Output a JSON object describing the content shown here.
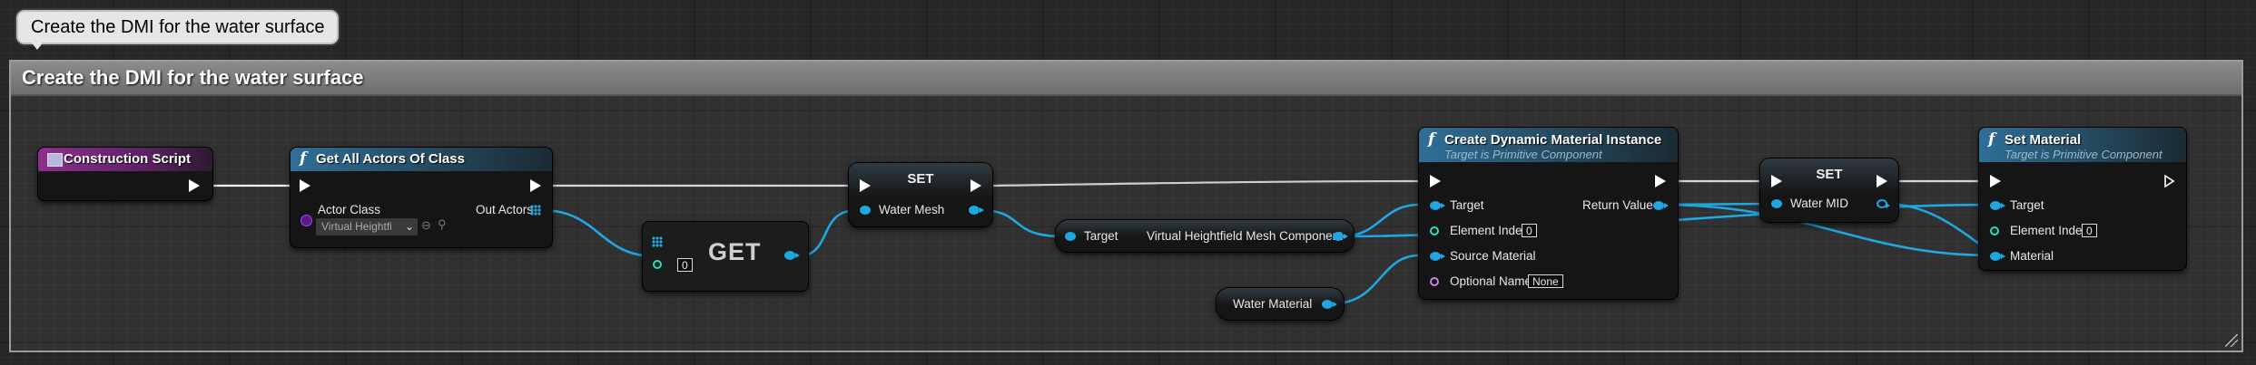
{
  "comment": {
    "bubble_text": "Create the DMI for the water surface",
    "title": "Create the DMI for the water surface"
  },
  "nodes": {
    "construction_script": {
      "title": "Construction Script"
    },
    "get_all_actors": {
      "title": "Get All Actors Of Class",
      "actor_class_label": "Actor Class",
      "actor_class_value": "Virtual Heightfi",
      "out_actors_label": "Out Actors"
    },
    "get_array": {
      "label": "GET",
      "index_value": "0"
    },
    "set_water_mesh": {
      "title": "SET",
      "pin_label": "Water Mesh"
    },
    "target_component": {
      "target_label": "Target",
      "component_label": "Virtual Heightfield Mesh Component"
    },
    "water_material": {
      "label": "Water Material"
    },
    "create_dmi": {
      "title": "Create Dynamic Material Instance",
      "subtitle": "Target is Primitive Component",
      "target_label": "Target",
      "element_index_label": "Element Index",
      "element_index_value": "0",
      "source_material_label": "Source Material",
      "optional_name_label": "Optional Name",
      "optional_name_value": "None",
      "return_value_label": "Return Value"
    },
    "set_water_mid": {
      "title": "SET",
      "pin_label": "Water MID"
    },
    "set_material": {
      "title": "Set Material",
      "subtitle": "Target is Primitive Component",
      "target_label": "Target",
      "element_index_label": "Element Index",
      "element_index_value": "0",
      "material_label": "Material"
    }
  },
  "colors": {
    "exec_wire": "#ffffff",
    "object_pin": "#1ea7e1",
    "int_pin": "#1fe4bf",
    "name_pin": "#c883e8",
    "class_pin": "#5a1a8c"
  },
  "icons": [
    "function-icon",
    "event-icon",
    "array-icon",
    "exec-pin-icon",
    "browse-icon",
    "search-icon",
    "dropdown-chevron-icon"
  ]
}
